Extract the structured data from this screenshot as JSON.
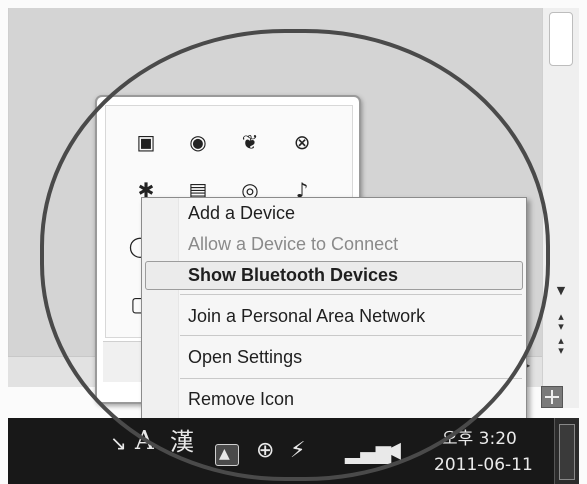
{
  "context_menu": {
    "items": [
      {
        "label": "Add a Device",
        "state": "normal"
      },
      {
        "label": "Allow a Device to Connect",
        "state": "disabled"
      },
      {
        "label": "Show Bluetooth Devices",
        "state": "default-highlighted"
      },
      {
        "label": "Join a Personal Area Network",
        "state": "normal"
      },
      {
        "label": "Open Settings",
        "state": "normal"
      },
      {
        "label": "Remove Icon",
        "state": "normal"
      }
    ]
  },
  "tray_overflow": {
    "icons": [
      "monitor-icon",
      "beats-audio-icon",
      "leaf-app-icon",
      "network-error-icon",
      "bluetooth-icon",
      "device-icon",
      "disk-icon",
      "speaker-icon",
      "clock-app-icon",
      "folder-icon"
    ]
  },
  "taskbar": {
    "ime_mode": "A",
    "ime_hanja": "漢",
    "tray_icons": [
      "show-hidden-icons-icon",
      "action-center-icon",
      "power-icon",
      "network-signal-icon",
      "volume-icon"
    ],
    "clock": {
      "time": "오후 3:20",
      "date": "2011-06-11"
    }
  },
  "highlight_color": "#4a4a4a"
}
